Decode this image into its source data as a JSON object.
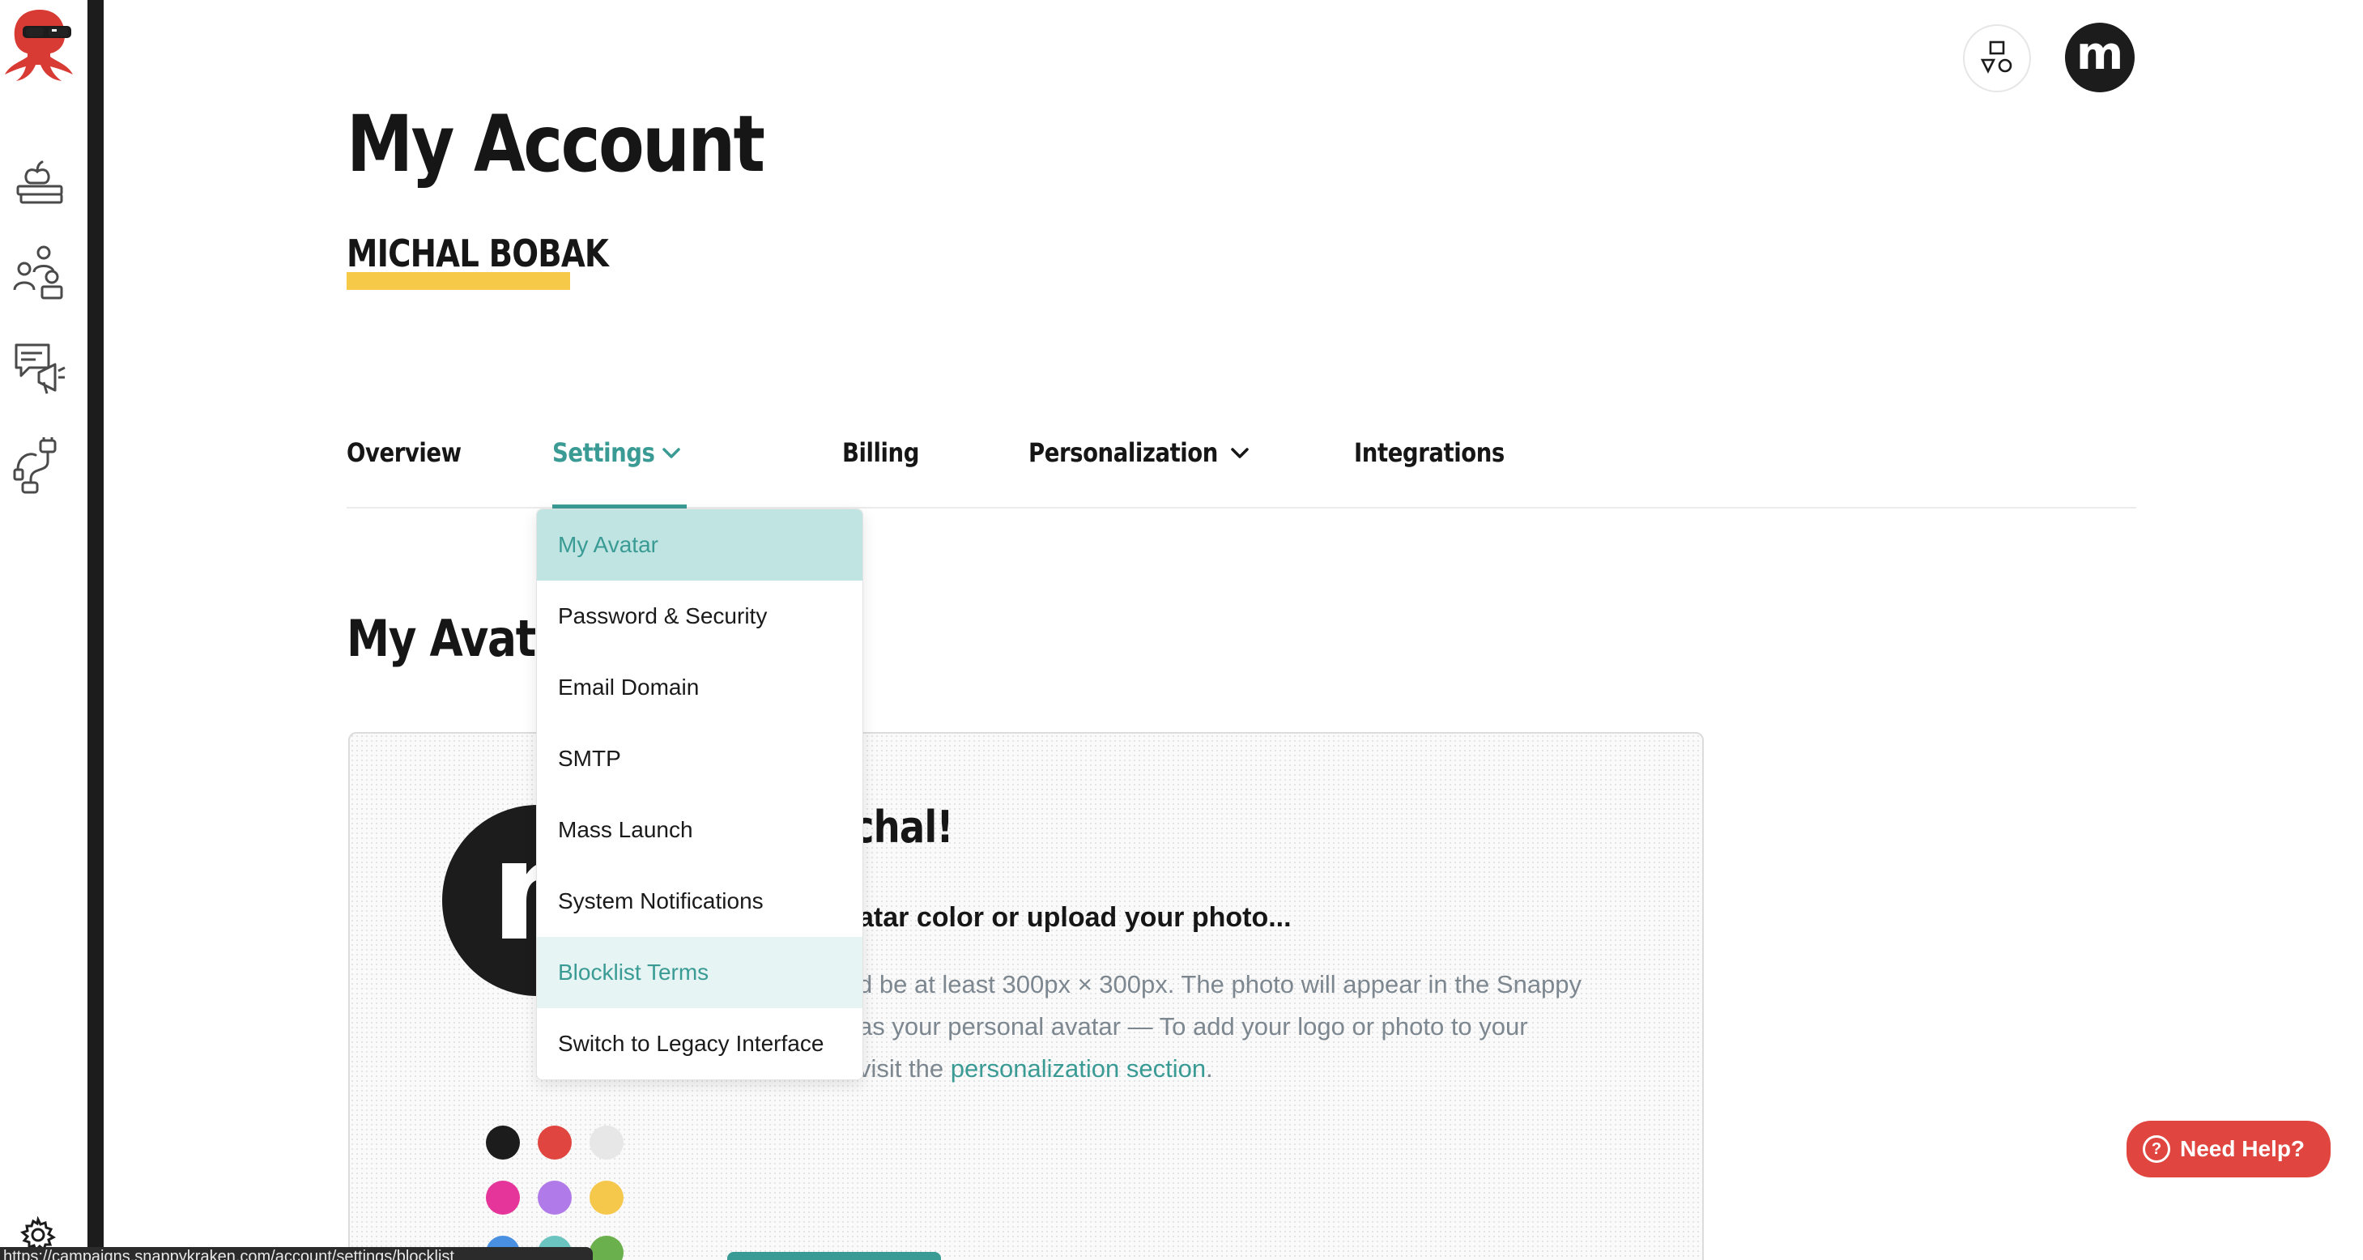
{
  "header": {
    "page_title": "My Account",
    "user_name": "MICHAL BOBAK",
    "user_initial": "m"
  },
  "sidebar": {
    "items": [
      {
        "icon": "books-apple-icon"
      },
      {
        "icon": "people-icon"
      },
      {
        "icon": "campaign-megaphone-icon"
      },
      {
        "icon": "integrations-plug-icon"
      }
    ],
    "footer_icon": "gear-icon"
  },
  "tabs": [
    {
      "label": "Overview",
      "active": false
    },
    {
      "label": "Settings",
      "active": true,
      "has_menu": true
    },
    {
      "label": "Billing",
      "active": false
    },
    {
      "label": "Personalization",
      "active": false,
      "has_menu": true
    },
    {
      "label": "Integrations",
      "active": false
    }
  ],
  "settings_menu": {
    "items": [
      {
        "label": "My Avatar",
        "state": "selected"
      },
      {
        "label": "Password & Security",
        "state": ""
      },
      {
        "label": "Email Domain",
        "state": ""
      },
      {
        "label": "SMTP",
        "state": ""
      },
      {
        "label": "Mass Launch",
        "state": ""
      },
      {
        "label": "System Notifications",
        "state": ""
      },
      {
        "label": "Blocklist Terms",
        "state": "hover"
      },
      {
        "label": "Switch to Legacy Interface",
        "state": ""
      }
    ]
  },
  "avatar_section": {
    "heading": "My Avatar",
    "avatar_letter": "m",
    "greeting_visible": "chal!",
    "subtitle_visible": "atar color or upload your photo...",
    "desc_line1": "d be at least 300px × 300px. The photo will appear in the Snappy",
    "desc_line2": "as your personal avatar — To add your logo or photo to your",
    "desc_line3_prefix": "visit the ",
    "desc_link": "personalization section",
    "desc_line3_suffix": ".",
    "swatches": [
      "#1c1c1c",
      "#e0463f",
      "#e7e7e7",
      "#e6359a",
      "#b07be8",
      "#f5c84c",
      "#4a90e2",
      "#6cc4c0",
      "#6ab04c"
    ]
  },
  "colors": {
    "accent": "#3a9b95",
    "highlight": "#f7c948",
    "help": "#e0463f"
  },
  "help_button": {
    "label": "Need Help?",
    "icon": "question-icon"
  },
  "status_bar": {
    "url": "https://campaigns.snappykraken.com/account/settings/blocklist"
  }
}
